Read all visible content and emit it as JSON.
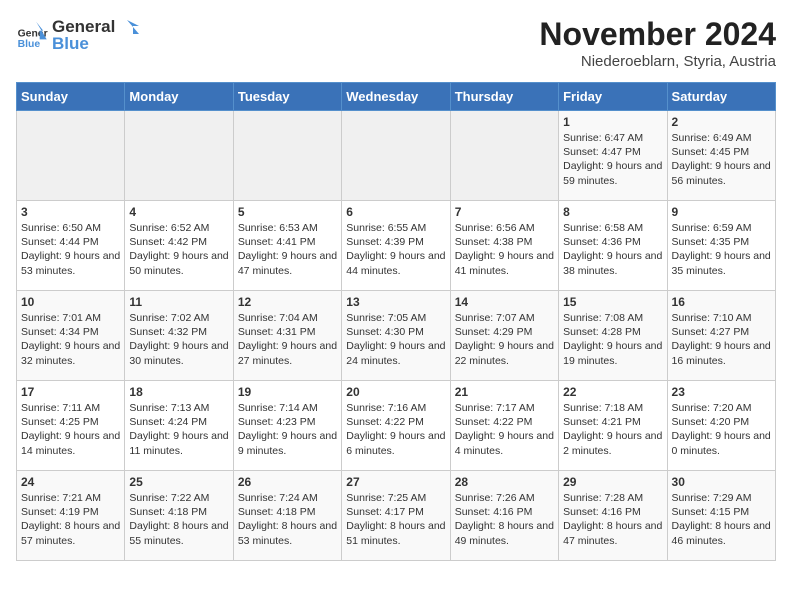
{
  "header": {
    "logo": {
      "text_general": "General",
      "text_blue": "Blue"
    },
    "title": "November 2024",
    "location": "Niederoeblarn, Styria, Austria"
  },
  "days_of_week": [
    "Sunday",
    "Monday",
    "Tuesday",
    "Wednesday",
    "Thursday",
    "Friday",
    "Saturday"
  ],
  "weeks": [
    [
      {
        "day": "",
        "empty": true
      },
      {
        "day": "",
        "empty": true
      },
      {
        "day": "",
        "empty": true
      },
      {
        "day": "",
        "empty": true
      },
      {
        "day": "",
        "empty": true
      },
      {
        "day": "1",
        "sunrise": "Sunrise: 6:47 AM",
        "sunset": "Sunset: 4:47 PM",
        "daylight": "Daylight: 9 hours and 59 minutes."
      },
      {
        "day": "2",
        "sunrise": "Sunrise: 6:49 AM",
        "sunset": "Sunset: 4:45 PM",
        "daylight": "Daylight: 9 hours and 56 minutes."
      }
    ],
    [
      {
        "day": "3",
        "sunrise": "Sunrise: 6:50 AM",
        "sunset": "Sunset: 4:44 PM",
        "daylight": "Daylight: 9 hours and 53 minutes."
      },
      {
        "day": "4",
        "sunrise": "Sunrise: 6:52 AM",
        "sunset": "Sunset: 4:42 PM",
        "daylight": "Daylight: 9 hours and 50 minutes."
      },
      {
        "day": "5",
        "sunrise": "Sunrise: 6:53 AM",
        "sunset": "Sunset: 4:41 PM",
        "daylight": "Daylight: 9 hours and 47 minutes."
      },
      {
        "day": "6",
        "sunrise": "Sunrise: 6:55 AM",
        "sunset": "Sunset: 4:39 PM",
        "daylight": "Daylight: 9 hours and 44 minutes."
      },
      {
        "day": "7",
        "sunrise": "Sunrise: 6:56 AM",
        "sunset": "Sunset: 4:38 PM",
        "daylight": "Daylight: 9 hours and 41 minutes."
      },
      {
        "day": "8",
        "sunrise": "Sunrise: 6:58 AM",
        "sunset": "Sunset: 4:36 PM",
        "daylight": "Daylight: 9 hours and 38 minutes."
      },
      {
        "day": "9",
        "sunrise": "Sunrise: 6:59 AM",
        "sunset": "Sunset: 4:35 PM",
        "daylight": "Daylight: 9 hours and 35 minutes."
      }
    ],
    [
      {
        "day": "10",
        "sunrise": "Sunrise: 7:01 AM",
        "sunset": "Sunset: 4:34 PM",
        "daylight": "Daylight: 9 hours and 32 minutes."
      },
      {
        "day": "11",
        "sunrise": "Sunrise: 7:02 AM",
        "sunset": "Sunset: 4:32 PM",
        "daylight": "Daylight: 9 hours and 30 minutes."
      },
      {
        "day": "12",
        "sunrise": "Sunrise: 7:04 AM",
        "sunset": "Sunset: 4:31 PM",
        "daylight": "Daylight: 9 hours and 27 minutes."
      },
      {
        "day": "13",
        "sunrise": "Sunrise: 7:05 AM",
        "sunset": "Sunset: 4:30 PM",
        "daylight": "Daylight: 9 hours and 24 minutes."
      },
      {
        "day": "14",
        "sunrise": "Sunrise: 7:07 AM",
        "sunset": "Sunset: 4:29 PM",
        "daylight": "Daylight: 9 hours and 22 minutes."
      },
      {
        "day": "15",
        "sunrise": "Sunrise: 7:08 AM",
        "sunset": "Sunset: 4:28 PM",
        "daylight": "Daylight: 9 hours and 19 minutes."
      },
      {
        "day": "16",
        "sunrise": "Sunrise: 7:10 AM",
        "sunset": "Sunset: 4:27 PM",
        "daylight": "Daylight: 9 hours and 16 minutes."
      }
    ],
    [
      {
        "day": "17",
        "sunrise": "Sunrise: 7:11 AM",
        "sunset": "Sunset: 4:25 PM",
        "daylight": "Daylight: 9 hours and 14 minutes."
      },
      {
        "day": "18",
        "sunrise": "Sunrise: 7:13 AM",
        "sunset": "Sunset: 4:24 PM",
        "daylight": "Daylight: 9 hours and 11 minutes."
      },
      {
        "day": "19",
        "sunrise": "Sunrise: 7:14 AM",
        "sunset": "Sunset: 4:23 PM",
        "daylight": "Daylight: 9 hours and 9 minutes."
      },
      {
        "day": "20",
        "sunrise": "Sunrise: 7:16 AM",
        "sunset": "Sunset: 4:22 PM",
        "daylight": "Daylight: 9 hours and 6 minutes."
      },
      {
        "day": "21",
        "sunrise": "Sunrise: 7:17 AM",
        "sunset": "Sunset: 4:22 PM",
        "daylight": "Daylight: 9 hours and 4 minutes."
      },
      {
        "day": "22",
        "sunrise": "Sunrise: 7:18 AM",
        "sunset": "Sunset: 4:21 PM",
        "daylight": "Daylight: 9 hours and 2 minutes."
      },
      {
        "day": "23",
        "sunrise": "Sunrise: 7:20 AM",
        "sunset": "Sunset: 4:20 PM",
        "daylight": "Daylight: 9 hours and 0 minutes."
      }
    ],
    [
      {
        "day": "24",
        "sunrise": "Sunrise: 7:21 AM",
        "sunset": "Sunset: 4:19 PM",
        "daylight": "Daylight: 8 hours and 57 minutes."
      },
      {
        "day": "25",
        "sunrise": "Sunrise: 7:22 AM",
        "sunset": "Sunset: 4:18 PM",
        "daylight": "Daylight: 8 hours and 55 minutes."
      },
      {
        "day": "26",
        "sunrise": "Sunrise: 7:24 AM",
        "sunset": "Sunset: 4:18 PM",
        "daylight": "Daylight: 8 hours and 53 minutes."
      },
      {
        "day": "27",
        "sunrise": "Sunrise: 7:25 AM",
        "sunset": "Sunset: 4:17 PM",
        "daylight": "Daylight: 8 hours and 51 minutes."
      },
      {
        "day": "28",
        "sunrise": "Sunrise: 7:26 AM",
        "sunset": "Sunset: 4:16 PM",
        "daylight": "Daylight: 8 hours and 49 minutes."
      },
      {
        "day": "29",
        "sunrise": "Sunrise: 7:28 AM",
        "sunset": "Sunset: 4:16 PM",
        "daylight": "Daylight: 8 hours and 47 minutes."
      },
      {
        "day": "30",
        "sunrise": "Sunrise: 7:29 AM",
        "sunset": "Sunset: 4:15 PM",
        "daylight": "Daylight: 8 hours and 46 minutes."
      }
    ]
  ]
}
